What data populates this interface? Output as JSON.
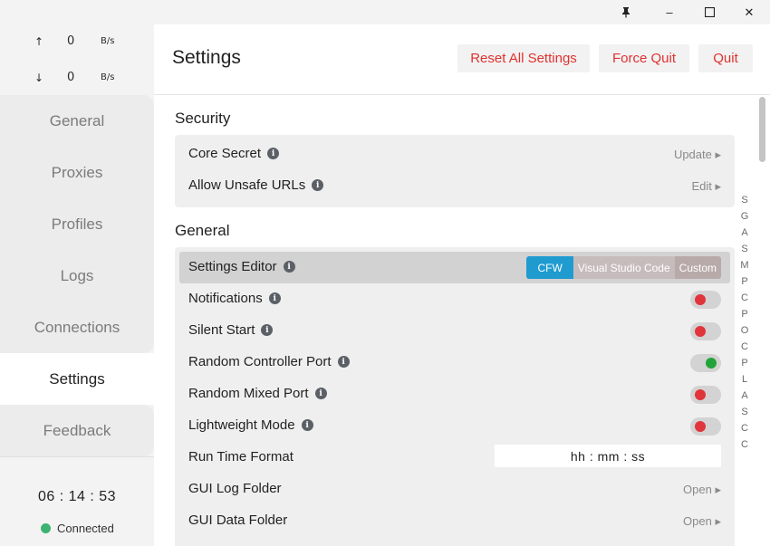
{
  "titlebar": {
    "pin": "📌",
    "minimize": "–",
    "maximize": "☐",
    "close": "✕"
  },
  "traffic": {
    "upload": {
      "arrow": "↑",
      "value": "0",
      "unit": "B/s"
    },
    "download": {
      "arrow": "↓",
      "value": "0",
      "unit": "B/s"
    }
  },
  "nav": {
    "items": [
      "General",
      "Proxies",
      "Profiles",
      "Logs",
      "Connections",
      "Settings",
      "Feedback"
    ],
    "active": "Settings"
  },
  "clock": "06 : 14 : 53",
  "status": "Connected",
  "header": {
    "title": "Settings",
    "reset_label": "Reset All Settings",
    "force_quit_label": "Force Quit",
    "quit_label": "Quit"
  },
  "security": {
    "title": "Security",
    "rows": [
      {
        "label": "Core Secret",
        "action": "Update ▸"
      },
      {
        "label": "Allow Unsafe URLs",
        "action": "Edit ▸"
      }
    ]
  },
  "general": {
    "title": "General",
    "settings_editor": {
      "label": "Settings Editor",
      "options": [
        "CFW",
        "Visual Studio Code",
        "Custom"
      ],
      "selected": "CFW"
    },
    "notifications": {
      "label": "Notifications",
      "on": false
    },
    "silent_start": {
      "label": "Silent Start",
      "on": false
    },
    "random_controller_port": {
      "label": "Random Controller Port",
      "on": true
    },
    "random_mixed_port": {
      "label": "Random Mixed Port",
      "on": false
    },
    "lightweight_mode": {
      "label": "Lightweight Mode",
      "on": false
    },
    "run_time_format": {
      "label": "Run Time Format",
      "value": "hh : mm : ss"
    },
    "gui_log_folder": {
      "label": "GUI Log Folder",
      "action": "Open ▸"
    },
    "gui_data_folder": {
      "label": "GUI Data Folder",
      "action": "Open ▸"
    }
  },
  "section_index": [
    "S",
    "G",
    "A",
    "S",
    "M",
    "P",
    "C",
    "P",
    "O",
    "C",
    "P",
    "L",
    "A",
    "S",
    "C",
    "C"
  ],
  "colors": {
    "accent": "#1f9bcf",
    "danger": "#e0322f",
    "toggle_off": "#e0353b",
    "toggle_on": "#22a33a",
    "connected": "#3cb371"
  }
}
